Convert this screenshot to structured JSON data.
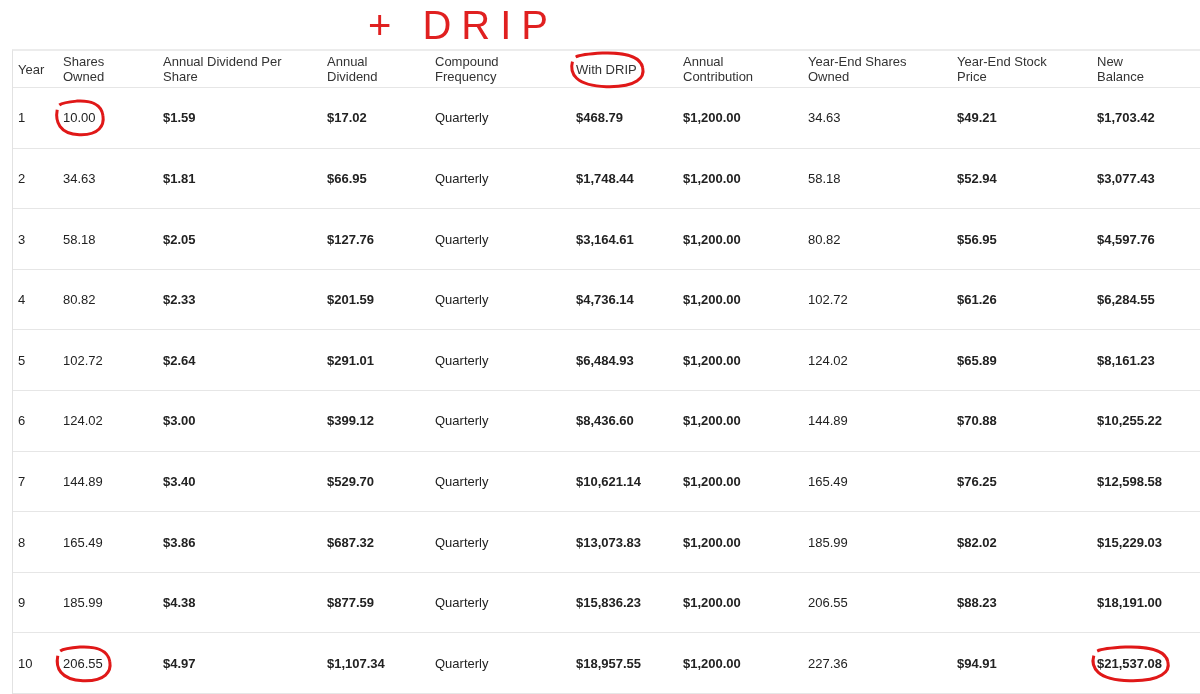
{
  "annotation": {
    "text": "+ DRIP"
  },
  "table": {
    "columns": [
      {
        "label": "Year",
        "kind": "plain",
        "circled": false
      },
      {
        "label": "Shares Owned",
        "kind": "plain",
        "circled": false
      },
      {
        "label": "Annual Dividend Per Share",
        "kind": "money",
        "circled": false
      },
      {
        "label": "Annual Dividend",
        "kind": "money",
        "circled": false
      },
      {
        "label": "Compound Frequency",
        "kind": "plain",
        "circled": false
      },
      {
        "label": "With DRIP",
        "kind": "money",
        "circled": true
      },
      {
        "label": "Annual Contribution",
        "kind": "money",
        "circled": false
      },
      {
        "label": "Year-End Shares Owned",
        "kind": "plain",
        "circled": false
      },
      {
        "label": "Year-End Stock Price",
        "kind": "money",
        "circled": false
      },
      {
        "label": "New Balance",
        "kind": "money",
        "circled": false
      }
    ],
    "rows": [
      {
        "cells": [
          {
            "text": "1",
            "circled": false
          },
          {
            "text": "10.00",
            "circled": true
          },
          {
            "text": "$1.59",
            "circled": false
          },
          {
            "text": "$17.02",
            "circled": false
          },
          {
            "text": "Quarterly",
            "circled": false
          },
          {
            "text": "$468.79",
            "circled": false
          },
          {
            "text": "$1,200.00",
            "circled": false
          },
          {
            "text": "34.63",
            "circled": false
          },
          {
            "text": "$49.21",
            "circled": false
          },
          {
            "text": "$1,703.42",
            "circled": false
          }
        ]
      },
      {
        "cells": [
          {
            "text": "2",
            "circled": false
          },
          {
            "text": "34.63",
            "circled": false
          },
          {
            "text": "$1.81",
            "circled": false
          },
          {
            "text": "$66.95",
            "circled": false
          },
          {
            "text": "Quarterly",
            "circled": false
          },
          {
            "text": "$1,748.44",
            "circled": false
          },
          {
            "text": "$1,200.00",
            "circled": false
          },
          {
            "text": "58.18",
            "circled": false
          },
          {
            "text": "$52.94",
            "circled": false
          },
          {
            "text": "$3,077.43",
            "circled": false
          }
        ]
      },
      {
        "cells": [
          {
            "text": "3",
            "circled": false
          },
          {
            "text": "58.18",
            "circled": false
          },
          {
            "text": "$2.05",
            "circled": false
          },
          {
            "text": "$127.76",
            "circled": false
          },
          {
            "text": "Quarterly",
            "circled": false
          },
          {
            "text": "$3,164.61",
            "circled": false
          },
          {
            "text": "$1,200.00",
            "circled": false
          },
          {
            "text": "80.82",
            "circled": false
          },
          {
            "text": "$56.95",
            "circled": false
          },
          {
            "text": "$4,597.76",
            "circled": false
          }
        ]
      },
      {
        "cells": [
          {
            "text": "4",
            "circled": false
          },
          {
            "text": "80.82",
            "circled": false
          },
          {
            "text": "$2.33",
            "circled": false
          },
          {
            "text": "$201.59",
            "circled": false
          },
          {
            "text": "Quarterly",
            "circled": false
          },
          {
            "text": "$4,736.14",
            "circled": false
          },
          {
            "text": "$1,200.00",
            "circled": false
          },
          {
            "text": "102.72",
            "circled": false
          },
          {
            "text": "$61.26",
            "circled": false
          },
          {
            "text": "$6,284.55",
            "circled": false
          }
        ]
      },
      {
        "cells": [
          {
            "text": "5",
            "circled": false
          },
          {
            "text": "102.72",
            "circled": false
          },
          {
            "text": "$2.64",
            "circled": false
          },
          {
            "text": "$291.01",
            "circled": false
          },
          {
            "text": "Quarterly",
            "circled": false
          },
          {
            "text": "$6,484.93",
            "circled": false
          },
          {
            "text": "$1,200.00",
            "circled": false
          },
          {
            "text": "124.02",
            "circled": false
          },
          {
            "text": "$65.89",
            "circled": false
          },
          {
            "text": "$8,161.23",
            "circled": false
          }
        ]
      },
      {
        "cells": [
          {
            "text": "6",
            "circled": false
          },
          {
            "text": "124.02",
            "circled": false
          },
          {
            "text": "$3.00",
            "circled": false
          },
          {
            "text": "$399.12",
            "circled": false
          },
          {
            "text": "Quarterly",
            "circled": false
          },
          {
            "text": "$8,436.60",
            "circled": false
          },
          {
            "text": "$1,200.00",
            "circled": false
          },
          {
            "text": "144.89",
            "circled": false
          },
          {
            "text": "$70.88",
            "circled": false
          },
          {
            "text": "$10,255.22",
            "circled": false
          }
        ]
      },
      {
        "cells": [
          {
            "text": "7",
            "circled": false
          },
          {
            "text": "144.89",
            "circled": false
          },
          {
            "text": "$3.40",
            "circled": false
          },
          {
            "text": "$529.70",
            "circled": false
          },
          {
            "text": "Quarterly",
            "circled": false
          },
          {
            "text": "$10,621.14",
            "circled": false
          },
          {
            "text": "$1,200.00",
            "circled": false
          },
          {
            "text": "165.49",
            "circled": false
          },
          {
            "text": "$76.25",
            "circled": false
          },
          {
            "text": "$12,598.58",
            "circled": false
          }
        ]
      },
      {
        "cells": [
          {
            "text": "8",
            "circled": false
          },
          {
            "text": "165.49",
            "circled": false
          },
          {
            "text": "$3.86",
            "circled": false
          },
          {
            "text": "$687.32",
            "circled": false
          },
          {
            "text": "Quarterly",
            "circled": false
          },
          {
            "text": "$13,073.83",
            "circled": false
          },
          {
            "text": "$1,200.00",
            "circled": false
          },
          {
            "text": "185.99",
            "circled": false
          },
          {
            "text": "$82.02",
            "circled": false
          },
          {
            "text": "$15,229.03",
            "circled": false
          }
        ]
      },
      {
        "cells": [
          {
            "text": "9",
            "circled": false
          },
          {
            "text": "185.99",
            "circled": false
          },
          {
            "text": "$4.38",
            "circled": false
          },
          {
            "text": "$877.59",
            "circled": false
          },
          {
            "text": "Quarterly",
            "circled": false
          },
          {
            "text": "$15,836.23",
            "circled": false
          },
          {
            "text": "$1,200.00",
            "circled": false
          },
          {
            "text": "206.55",
            "circled": false
          },
          {
            "text": "$88.23",
            "circled": false
          },
          {
            "text": "$18,191.00",
            "circled": false
          }
        ]
      },
      {
        "cells": [
          {
            "text": "10",
            "circled": false
          },
          {
            "text": "206.55",
            "circled": true
          },
          {
            "text": "$4.97",
            "circled": false
          },
          {
            "text": "$1,107.34",
            "circled": false
          },
          {
            "text": "Quarterly",
            "circled": false
          },
          {
            "text": "$18,957.55",
            "circled": false
          },
          {
            "text": "$1,200.00",
            "circled": false
          },
          {
            "text": "227.36",
            "circled": false
          },
          {
            "text": "$94.91",
            "circled": false
          },
          {
            "text": "$21,537.08",
            "circled": true
          }
        ]
      }
    ]
  }
}
